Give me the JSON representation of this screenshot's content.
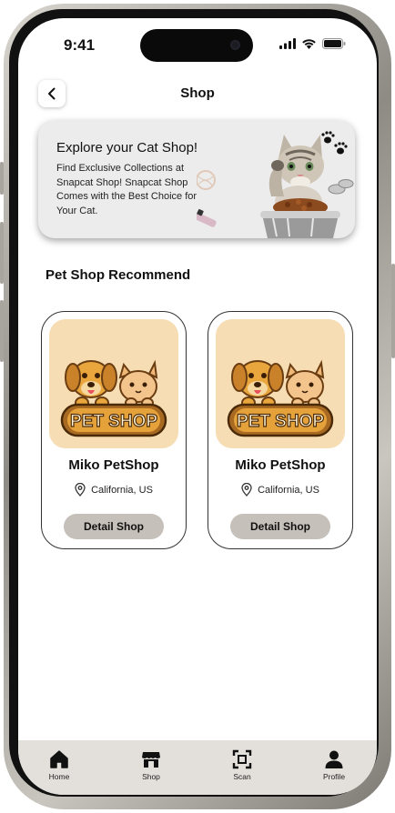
{
  "status": {
    "time": "9:41"
  },
  "header": {
    "title": "Shop",
    "back_icon": "chevron-left-icon"
  },
  "banner": {
    "title": "Explore your Cat Shop!",
    "text": "Find Exclusive Collections at Snapcat Shop! Snapcat Shop Comes with the Best Choice for Your Cat."
  },
  "section": {
    "title": "Pet Shop Recommend"
  },
  "shops": [
    {
      "logo_text": "PET SHOP",
      "name": "Miko PetShop",
      "location": "California, US",
      "button": "Detail Shop"
    },
    {
      "logo_text": "PET SHOP",
      "name": "Miko PetShop",
      "location": "California, US",
      "button": "Detail Shop"
    }
  ],
  "tabs": [
    {
      "label": "Home",
      "icon": "home-icon"
    },
    {
      "label": "Shop",
      "icon": "store-icon"
    },
    {
      "label": "Scan",
      "icon": "scan-icon"
    },
    {
      "label": "Profile",
      "icon": "profile-icon"
    }
  ],
  "colors": {
    "logo_bg": "#f6ddb3",
    "button_bg": "#c6c0ba",
    "tab_bar_bg": "#e3e0dc"
  }
}
